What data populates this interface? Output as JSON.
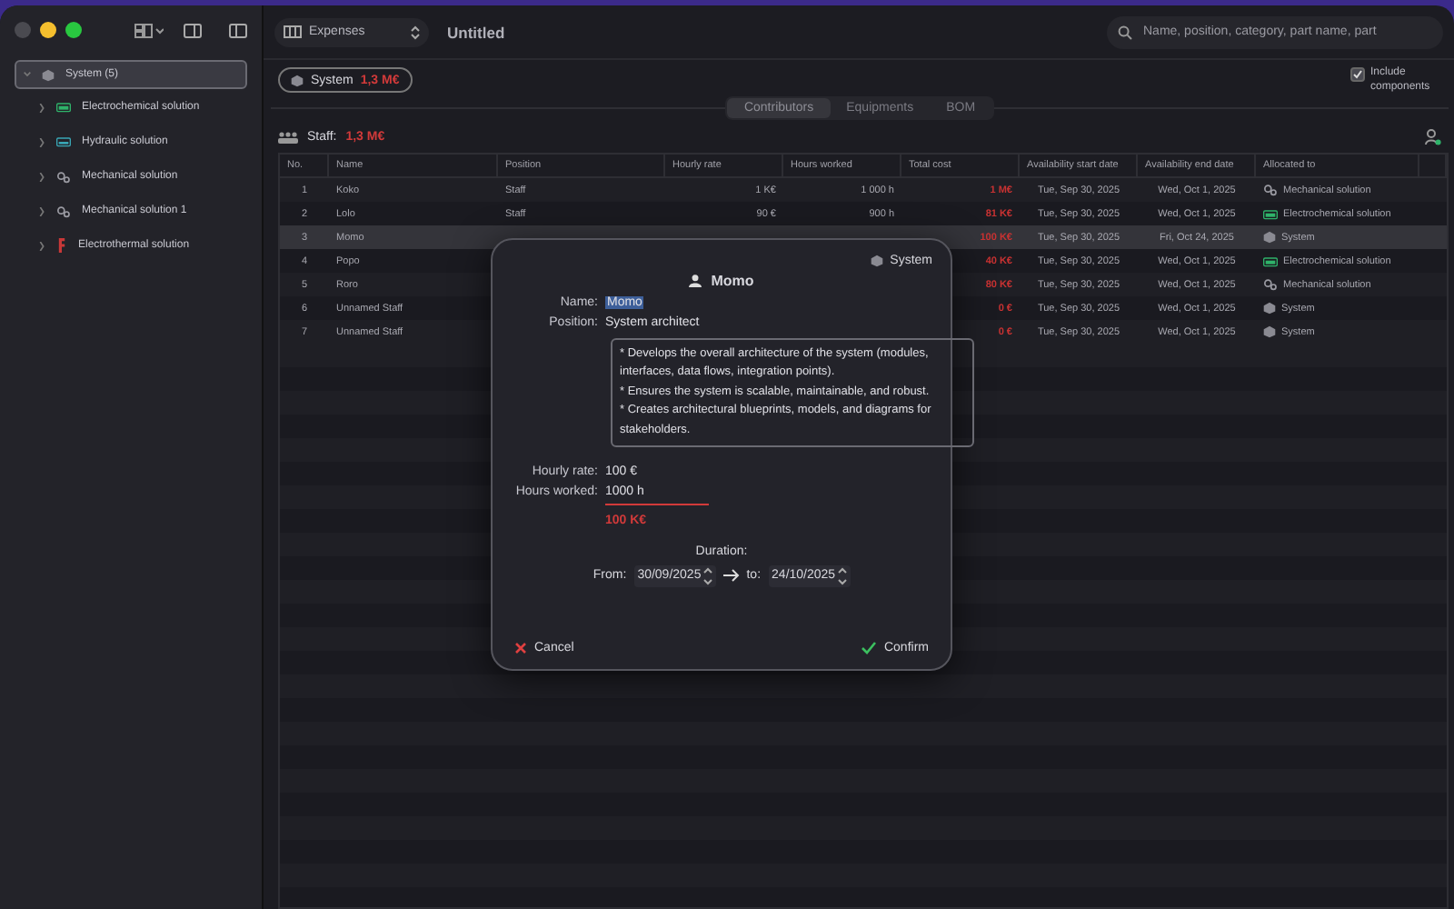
{
  "toolbar": {
    "document_type": "Expenses",
    "title": "Untitled",
    "search": {
      "placeholder": "Name, position, category, part name, part"
    }
  },
  "sidebar": {
    "items": [
      {
        "label": "System (5)",
        "kind": "system",
        "selected": true,
        "children": [
          {
            "label": "Electrochemical solution",
            "kind": "electrochemical",
            "selected": false
          },
          {
            "label": "Hydraulic solution",
            "kind": "hydraulic",
            "selected": false
          },
          {
            "label": "Mechanical solution",
            "kind": "mechanical",
            "selected": false
          },
          {
            "label": "Mechanical solution 1",
            "kind": "mechanical",
            "selected": false
          },
          {
            "label": "Electrothermal solution",
            "kind": "electrothermal",
            "selected": false
          }
        ]
      }
    ]
  },
  "scope_chip": {
    "label": "System",
    "amount": "1,3 M€"
  },
  "include_components": {
    "label": "Include components",
    "checked": true
  },
  "tabs": [
    {
      "label": "Contributors",
      "selected": true
    },
    {
      "label": "Equipments",
      "selected": false
    },
    {
      "label": "BOM",
      "selected": false
    }
  ],
  "staff_summary": {
    "label": "Staff:",
    "amount": "1,3 M€"
  },
  "table": {
    "columns": [
      "No.",
      "Name",
      "Position",
      "Hourly rate",
      "Hours worked",
      "Total cost",
      "Availability start date",
      "Availability end date",
      "Allocated to"
    ],
    "rows": [
      {
        "no": "1",
        "name": "Koko",
        "position": "Staff",
        "rate": "1 K€",
        "hours": "1 000 h",
        "cost": "1 M€",
        "start": "Tue, Sep 30, 2025",
        "end": "Wed, Oct 1, 2025",
        "allocated": "Mechanical solution",
        "kind": "mechanical",
        "selected": false
      },
      {
        "no": "2",
        "name": "Lolo",
        "position": "Staff",
        "rate": "90 €",
        "hours": "900 h",
        "cost": "81 K€",
        "start": "Tue, Sep 30, 2025",
        "end": "Wed, Oct 1, 2025",
        "allocated": "Electrochemical solution",
        "kind": "electrochemical",
        "selected": false
      },
      {
        "no": "3",
        "name": "Momo",
        "cost": "100 K€",
        "start": "Tue, Sep 30, 2025",
        "end": "Fri, Oct 24, 2025",
        "allocated": "System",
        "kind": "system",
        "selected": true
      },
      {
        "no": "4",
        "name": "Popo",
        "cost": "40 K€",
        "start": "Tue, Sep 30, 2025",
        "end": "Wed, Oct 1, 2025",
        "allocated": "Electrochemical solution",
        "kind": "electrochemical",
        "selected": false
      },
      {
        "no": "5",
        "name": "Roro",
        "cost": "80 K€",
        "start": "Tue, Sep 30, 2025",
        "end": "Wed, Oct 1, 2025",
        "allocated": "Mechanical solution",
        "kind": "mechanical",
        "selected": false
      },
      {
        "no": "6",
        "name": "Unnamed Staff",
        "cost": "0 €",
        "start": "Tue, Sep 30, 2025",
        "end": "Wed, Oct 1, 2025",
        "allocated": "System",
        "kind": "system",
        "selected": false
      },
      {
        "no": "7",
        "name": "Unnamed Staff",
        "cost": "0 €",
        "start": "Tue, Sep 30, 2025",
        "end": "Wed, Oct 1, 2025",
        "allocated": "System",
        "kind": "system",
        "selected": false
      }
    ]
  },
  "dialog": {
    "scope": "System",
    "title": "Momo",
    "fields": [
      {
        "label": "Name:",
        "value": "Momo"
      },
      {
        "label": "Position:",
        "value": "System architect"
      }
    ],
    "description": [
      "* Develops the overall architecture of the system (modules, interfaces, data flows, integration points).",
      "* Ensures the system is scalable, maintainable, and robust.",
      "* Creates architectural blueprints, models, and diagrams for stakeholders."
    ],
    "cost_fields": [
      {
        "label": "Hourly rate:",
        "value": "100 €"
      },
      {
        "label": "Hours worked:",
        "value": "1000 h"
      }
    ],
    "total": "100 K€",
    "duration": {
      "label": "Duration:",
      "from_label": "From:",
      "from": "30/09/2025",
      "to_label": "to:",
      "to": "24/10/2025"
    },
    "cancel": "Cancel",
    "confirm": "Confirm"
  }
}
